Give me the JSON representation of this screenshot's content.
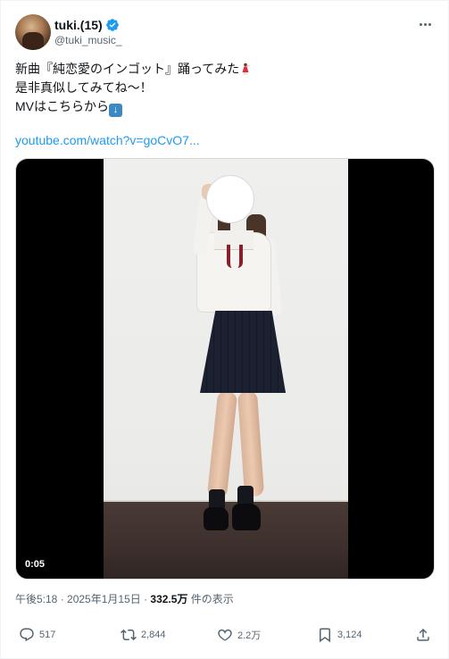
{
  "author": {
    "display_name": "tuki.(15)",
    "handle": "@tuki_music_",
    "verified_icon": "verified-badge-icon"
  },
  "tweet": {
    "line1": "新曲『純恋愛のインゴット』踊ってみた",
    "line2": "是非真似してみてね〜！",
    "line3": "MVはこちらから",
    "link": "youtube.com/watch?v=goCvO7..."
  },
  "video": {
    "duration": "0:05"
  },
  "meta": {
    "time_date": "午後5:18 · 2025年1月15日 · ",
    "views": "332.5万",
    "views_suffix": " 件の表示"
  },
  "actions": {
    "replies": "517",
    "reposts": "2,844",
    "likes": "2.2万",
    "bookmarks": "3,124"
  },
  "colors": {
    "link": "#1d9bf0",
    "secondary_text": "#536471",
    "primary_text": "#0f1419"
  }
}
